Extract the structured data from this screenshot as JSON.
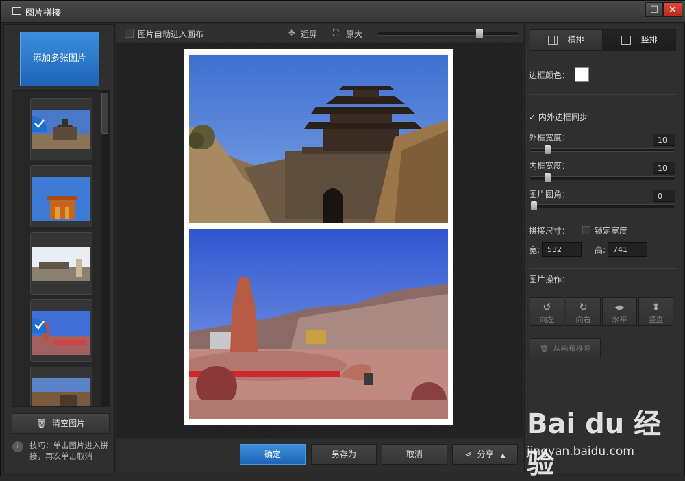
{
  "window": {
    "title": "图片拼接",
    "maximize_glyph": "□",
    "close_glyph": "✕"
  },
  "left": {
    "add_button": "添加多张图片",
    "thumbnails": [
      {
        "name": "城楼",
        "selected": true
      },
      {
        "name": "牌坊",
        "selected": false
      },
      {
        "name": "庙宇",
        "selected": false
      },
      {
        "name": "雕像",
        "selected": true
      },
      {
        "name": "楼阁",
        "selected": false
      }
    ],
    "clear_button": "清空图片",
    "tip": "技巧：单击图片进入拼接，再次单击取消"
  },
  "toolbar": {
    "auto_canvas_label": "图片自动进入画布",
    "auto_canvas_checked": false,
    "fit_label": "适屏",
    "original_label": "原大",
    "zoom_level": 0.73
  },
  "canvas": {
    "photos": [
      {
        "name": "城门楼阁"
      },
      {
        "name": "红石雕像"
      }
    ]
  },
  "bottom": {
    "ok": "确定",
    "save_as": "另存为",
    "cancel": "取消",
    "share": "分享"
  },
  "right": {
    "layout_horizontal": "横排",
    "layout_vertical": "竖排",
    "active_layout": "vertical",
    "border_color_label": "边框颜色：",
    "border_color": "#ffffff",
    "sync_label": "内外边框同步",
    "sync_checked": true,
    "outer_label": "外框宽度：",
    "outer_value": "10",
    "inner_label": "内框宽度：",
    "inner_value": "10",
    "radius_label": "图片圆角：",
    "radius_value": "0",
    "size_label": "拼接尺寸：",
    "lock_label": "锁定宽度",
    "lock_checked": false,
    "width_label": "宽:",
    "width_value": "532",
    "height_label": "高:",
    "height_value": "741",
    "ops_label": "图片操作：",
    "ops": [
      "向左",
      "向右",
      "水平",
      "竖直"
    ],
    "remove_button": "从画布移除"
  },
  "watermark": {
    "brand": "Bai du 经验",
    "url": "jingyan.baidu.com"
  }
}
